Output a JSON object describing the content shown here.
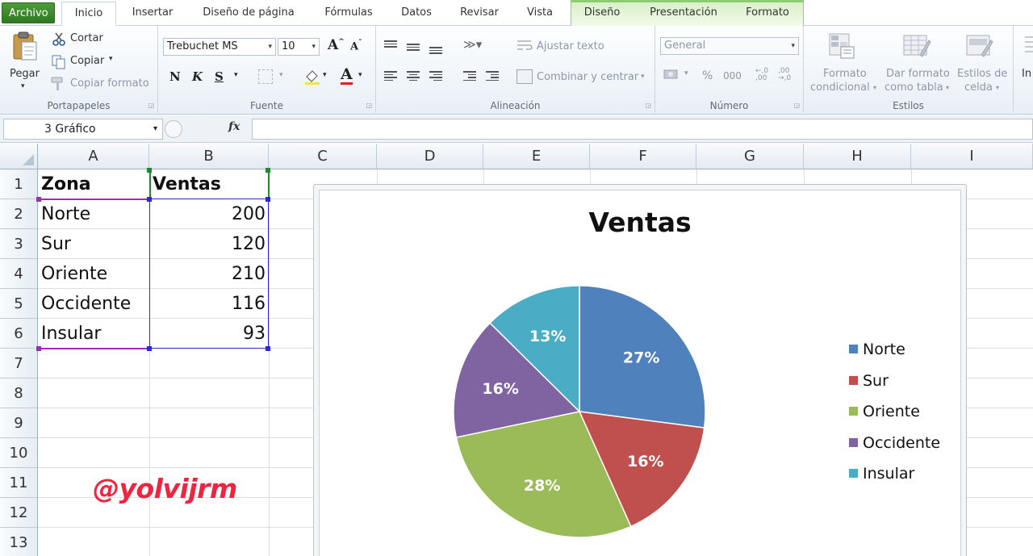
{
  "ribbon_tabs": [
    "Archivo",
    "Inicio",
    "Insertar",
    "Diseño de página",
    "Fórmulas",
    "Datos",
    "Revisar",
    "Vista",
    "Diseño",
    "Presentación",
    "Formato"
  ],
  "clipboard": {
    "paste": "Pegar",
    "cut": "Cortar",
    "copy": "Copiar",
    "format_painter": "Copiar formato",
    "label": "Portapapeles"
  },
  "font": {
    "family": "Trebuchet MS",
    "size": "10",
    "bold": "N",
    "italic": "K",
    "underline": "S",
    "label": "Fuente"
  },
  "alignment": {
    "wrap_text": "Ajustar texto",
    "merge_center": "Combinar y centrar",
    "label": "Alineación"
  },
  "number": {
    "format": "General",
    "percent": "%",
    "thousands": "000",
    "label": "Número"
  },
  "styles": {
    "conditional_line1": "Formato",
    "conditional_line2": "condicional",
    "table_line1": "Dar formato",
    "table_line2": "como tabla",
    "cell_line1": "Estilos de",
    "cell_line2": "celda",
    "label": "Estilos"
  },
  "insert_partial": "In",
  "formula_bar": {
    "name_box": "3 Gráfico",
    "fx": "fx",
    "formula": ""
  },
  "columns": [
    "A",
    "B",
    "C",
    "D",
    "E",
    "F",
    "G",
    "H",
    "I"
  ],
  "rows": [
    "1",
    "2",
    "3",
    "4",
    "5",
    "6",
    "7",
    "8",
    "9",
    "10",
    "11",
    "12",
    "13"
  ],
  "table": {
    "headers": [
      "Zona",
      "Ventas"
    ],
    "rows": [
      [
        "Norte",
        "200"
      ],
      [
        "Sur",
        "120"
      ],
      [
        "Oriente",
        "210"
      ],
      [
        "Occidente",
        "116"
      ],
      [
        "Insular",
        "93"
      ]
    ]
  },
  "watermark": "@yolvijrm",
  "chart_data": {
    "type": "pie",
    "title": "Ventas",
    "categories": [
      "Norte",
      "Sur",
      "Oriente",
      "Occidente",
      "Insular"
    ],
    "values": [
      200,
      120,
      210,
      116,
      93
    ],
    "data_labels": [
      "27%",
      "16%",
      "28%",
      "16%",
      "13%"
    ],
    "colors": [
      "#4f81bd",
      "#c0504d",
      "#9bbb59",
      "#8064a2",
      "#4bacc6"
    ],
    "legend_position": "right"
  }
}
